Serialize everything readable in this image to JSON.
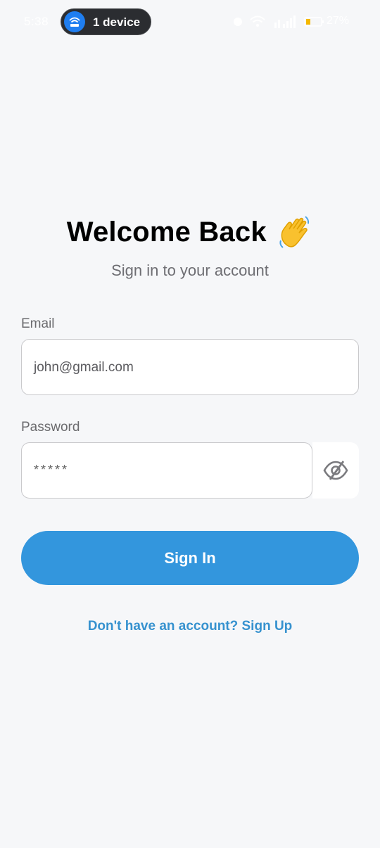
{
  "status_bar": {
    "time": "5:38",
    "device_pill_label": "1 device",
    "battery_percent": "27%",
    "icons": [
      "alarm-icon",
      "wifi-icon",
      "signal-icon",
      "battery-icon"
    ]
  },
  "login": {
    "title": "Welcome Back",
    "title_emoji": "waving-hand-icon",
    "subtitle": "Sign in to your account",
    "email_label": "Email",
    "email_value": "john@gmail.com",
    "password_label": "Password",
    "password_value_masked": "*****",
    "password_toggle_icon": "eye-off-icon",
    "sign_in_label": "Sign In",
    "signup_link": "Don't have an account? Sign Up"
  },
  "colors": {
    "accent": "#3396dd",
    "link": "#3792cf",
    "background": "#f6f7f9"
  }
}
